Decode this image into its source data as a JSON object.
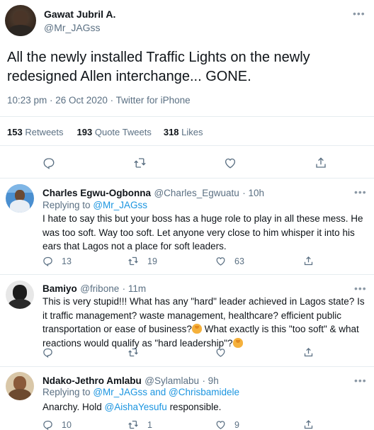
{
  "main_tweet": {
    "author_name": "Gawat Jubril A.",
    "author_handle": "@Mr_JAGss",
    "text": "All the newly installed Traffic Lights on the newly redesigned Allen interchange... GONE.",
    "meta": "10:23 pm · 26 Oct 2020 · Twitter for iPhone",
    "stats": {
      "retweets_count": "153",
      "retweets_label": "Retweets",
      "quotes_count": "193",
      "quotes_label": "Quote Tweets",
      "likes_count": "318",
      "likes_label": "Likes"
    },
    "actions": [
      "reply-icon",
      "retweet-icon",
      "like-icon",
      "share-icon"
    ]
  },
  "replies": [
    {
      "name": "Charles Egwu-Ogbonna",
      "handle": "@Charles_Egwuatu",
      "time": "· 10h",
      "replying_prefix": "Replying to",
      "replying_to": "@Mr_JAGss",
      "text": "I hate to say this but your boss has a huge role to play in all these mess. He was too soft. Way too soft. Let anyone very close to him whisper it into his ears that Lagos not a place for soft leaders.",
      "reply_count": "13",
      "retweet_count": "19",
      "like_count": "63"
    },
    {
      "name": "Bamiyo",
      "handle": "@fribone",
      "time": "· 11m",
      "text_part1": "This is very stupid!!! What has any \"hard\" leader achieved in Lagos state? Is it traffic management? waste management, healthcare? efficient public transportation or ease of business?",
      "text_part2": " What exactly is this \"too soft\" & what reactions would qualify as \"hard leadership\"?",
      "reply_count": "",
      "retweet_count": "",
      "like_count": ""
    },
    {
      "name": "Ndako-Jethro Amlabu",
      "handle": "@Sylamlabu",
      "time": "· 9h",
      "replying_prefix": "Replying to",
      "replying_to": "@Mr_JAGss and @Chrisbamidele",
      "text_prefix": "Anarchy. Hold ",
      "mention": "@AishaYesufu",
      "text_suffix": " responsible.",
      "reply_count": "10",
      "retweet_count": "1",
      "like_count": "9"
    }
  ],
  "more_label": "•••"
}
